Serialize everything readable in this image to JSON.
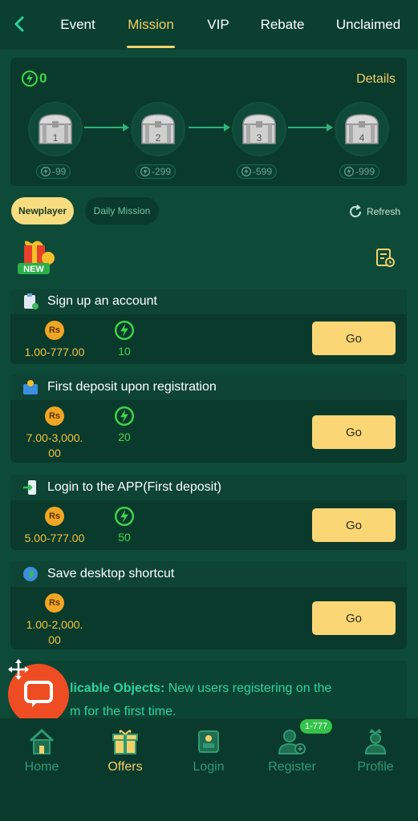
{
  "tabs": [
    {
      "label": "Event"
    },
    {
      "label": "Mission"
    },
    {
      "label": "VIP"
    },
    {
      "label": "Rebate"
    },
    {
      "label": "Unclaimed"
    }
  ],
  "active_tab": "Mission",
  "treasure": {
    "energy": "0",
    "details_label": "Details",
    "chests": [
      {
        "number": "1",
        "cost": "-99"
      },
      {
        "number": "2",
        "cost": "-299"
      },
      {
        "number": "3",
        "cost": "-599"
      },
      {
        "number": "4",
        "cost": "-999"
      }
    ]
  },
  "filters": {
    "newplayer": "Newplayer",
    "daily": "Daily Mission",
    "refresh": "Refresh"
  },
  "new_badge": "NEW",
  "coin_symbol": "Rs",
  "missions": [
    {
      "title": "Sign up an account",
      "amount": "1.00-777.00",
      "energy": "10",
      "button": "Go",
      "icon": "clipboard-icon"
    },
    {
      "title": "First deposit upon registration",
      "amount": "7.00-3,000.\n00",
      "energy": "20",
      "button": "Go",
      "icon": "wallet-icon"
    },
    {
      "title": "Login to the APP(First deposit)",
      "amount": "5.00-777.00",
      "energy": "50",
      "button": "Go",
      "icon": "phone-login-icon"
    },
    {
      "title": "Save desktop shortcut",
      "amount": "1.00-2,000.\n00",
      "energy": "",
      "button": "Go",
      "icon": "globe-icon"
    }
  ],
  "info": {
    "label": "licable Objects:",
    "text": " New users registering on the",
    "text2": "m for the first time."
  },
  "bottom_nav": [
    {
      "label": "Home",
      "icon": "home-icon"
    },
    {
      "label": "Offers",
      "icon": "gift-icon"
    },
    {
      "label": "Login",
      "icon": "login-icon"
    },
    {
      "label": "Register",
      "icon": "register-icon"
    },
    {
      "label": "Profile",
      "icon": "profile-icon"
    }
  ],
  "register_badge": "1-777",
  "colors": {
    "background": "#0e4a38",
    "accent": "#f3d06a",
    "energy_green": "#3fd84a",
    "button": "#fbd675",
    "chat": "#ee4d24"
  }
}
